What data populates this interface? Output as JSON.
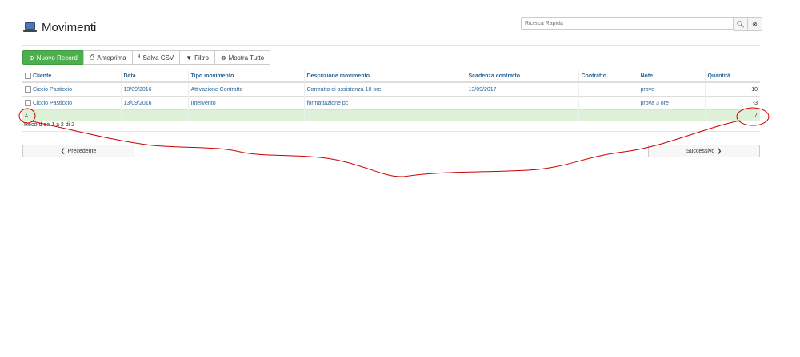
{
  "page": {
    "title": "Movimenti",
    "icon": "laptop-icon"
  },
  "search": {
    "placeholder": "Ricerca Rapida",
    "search_icon": "search-icon",
    "clear_icon": "clear-icon"
  },
  "toolbar": {
    "new_label": "Nuovo Record",
    "preview_label": "Anteprima",
    "csv_label": "Salva CSV",
    "filter_label": "Filtro",
    "showall_label": "Mostra Tutto"
  },
  "table": {
    "headers": [
      "Cliente",
      "Data",
      "Tipo movimento",
      "Descrizione movimento",
      "Scadenza contratto",
      "Contratto",
      "Note",
      "Quantità"
    ],
    "rows": [
      [
        "Ciccio Pasticcio",
        "13/09/2016",
        "Attivazione Contratto",
        "Contratto di assistenza 10 ore",
        "13/09/2017",
        "",
        "prove",
        "10"
      ],
      [
        "Ciccio Pasticcio",
        "13/09/2016",
        "Intervento",
        "formattazione pc",
        "",
        "",
        "prova 3 ore",
        "-3"
      ]
    ],
    "total_symbol": "Σ",
    "total_value": "7"
  },
  "records_info": "Record da 1 a 2 di 2",
  "pager": {
    "prev_label": "Precedente",
    "next_label": "Successivo"
  },
  "colors": {
    "accent": "#4cae4c",
    "link": "#2a6496",
    "total_row": "#dff0d8",
    "annotation": "#cc0000"
  }
}
